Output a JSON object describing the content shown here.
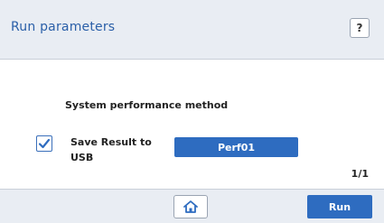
{
  "header": {
    "title": "Run parameters",
    "help_label": "?"
  },
  "main": {
    "method_label": "System performance method",
    "save_checkbox": {
      "checked": true,
      "label": "Save Result to USB"
    },
    "method_value": "Perf01",
    "page_indicator": "1/1"
  },
  "footer": {
    "home_icon": "home-icon",
    "run_label": "Run"
  },
  "colors": {
    "accent": "#2e6cc0",
    "title_text": "#2a5fa8",
    "bar_background": "#e9edf3"
  }
}
